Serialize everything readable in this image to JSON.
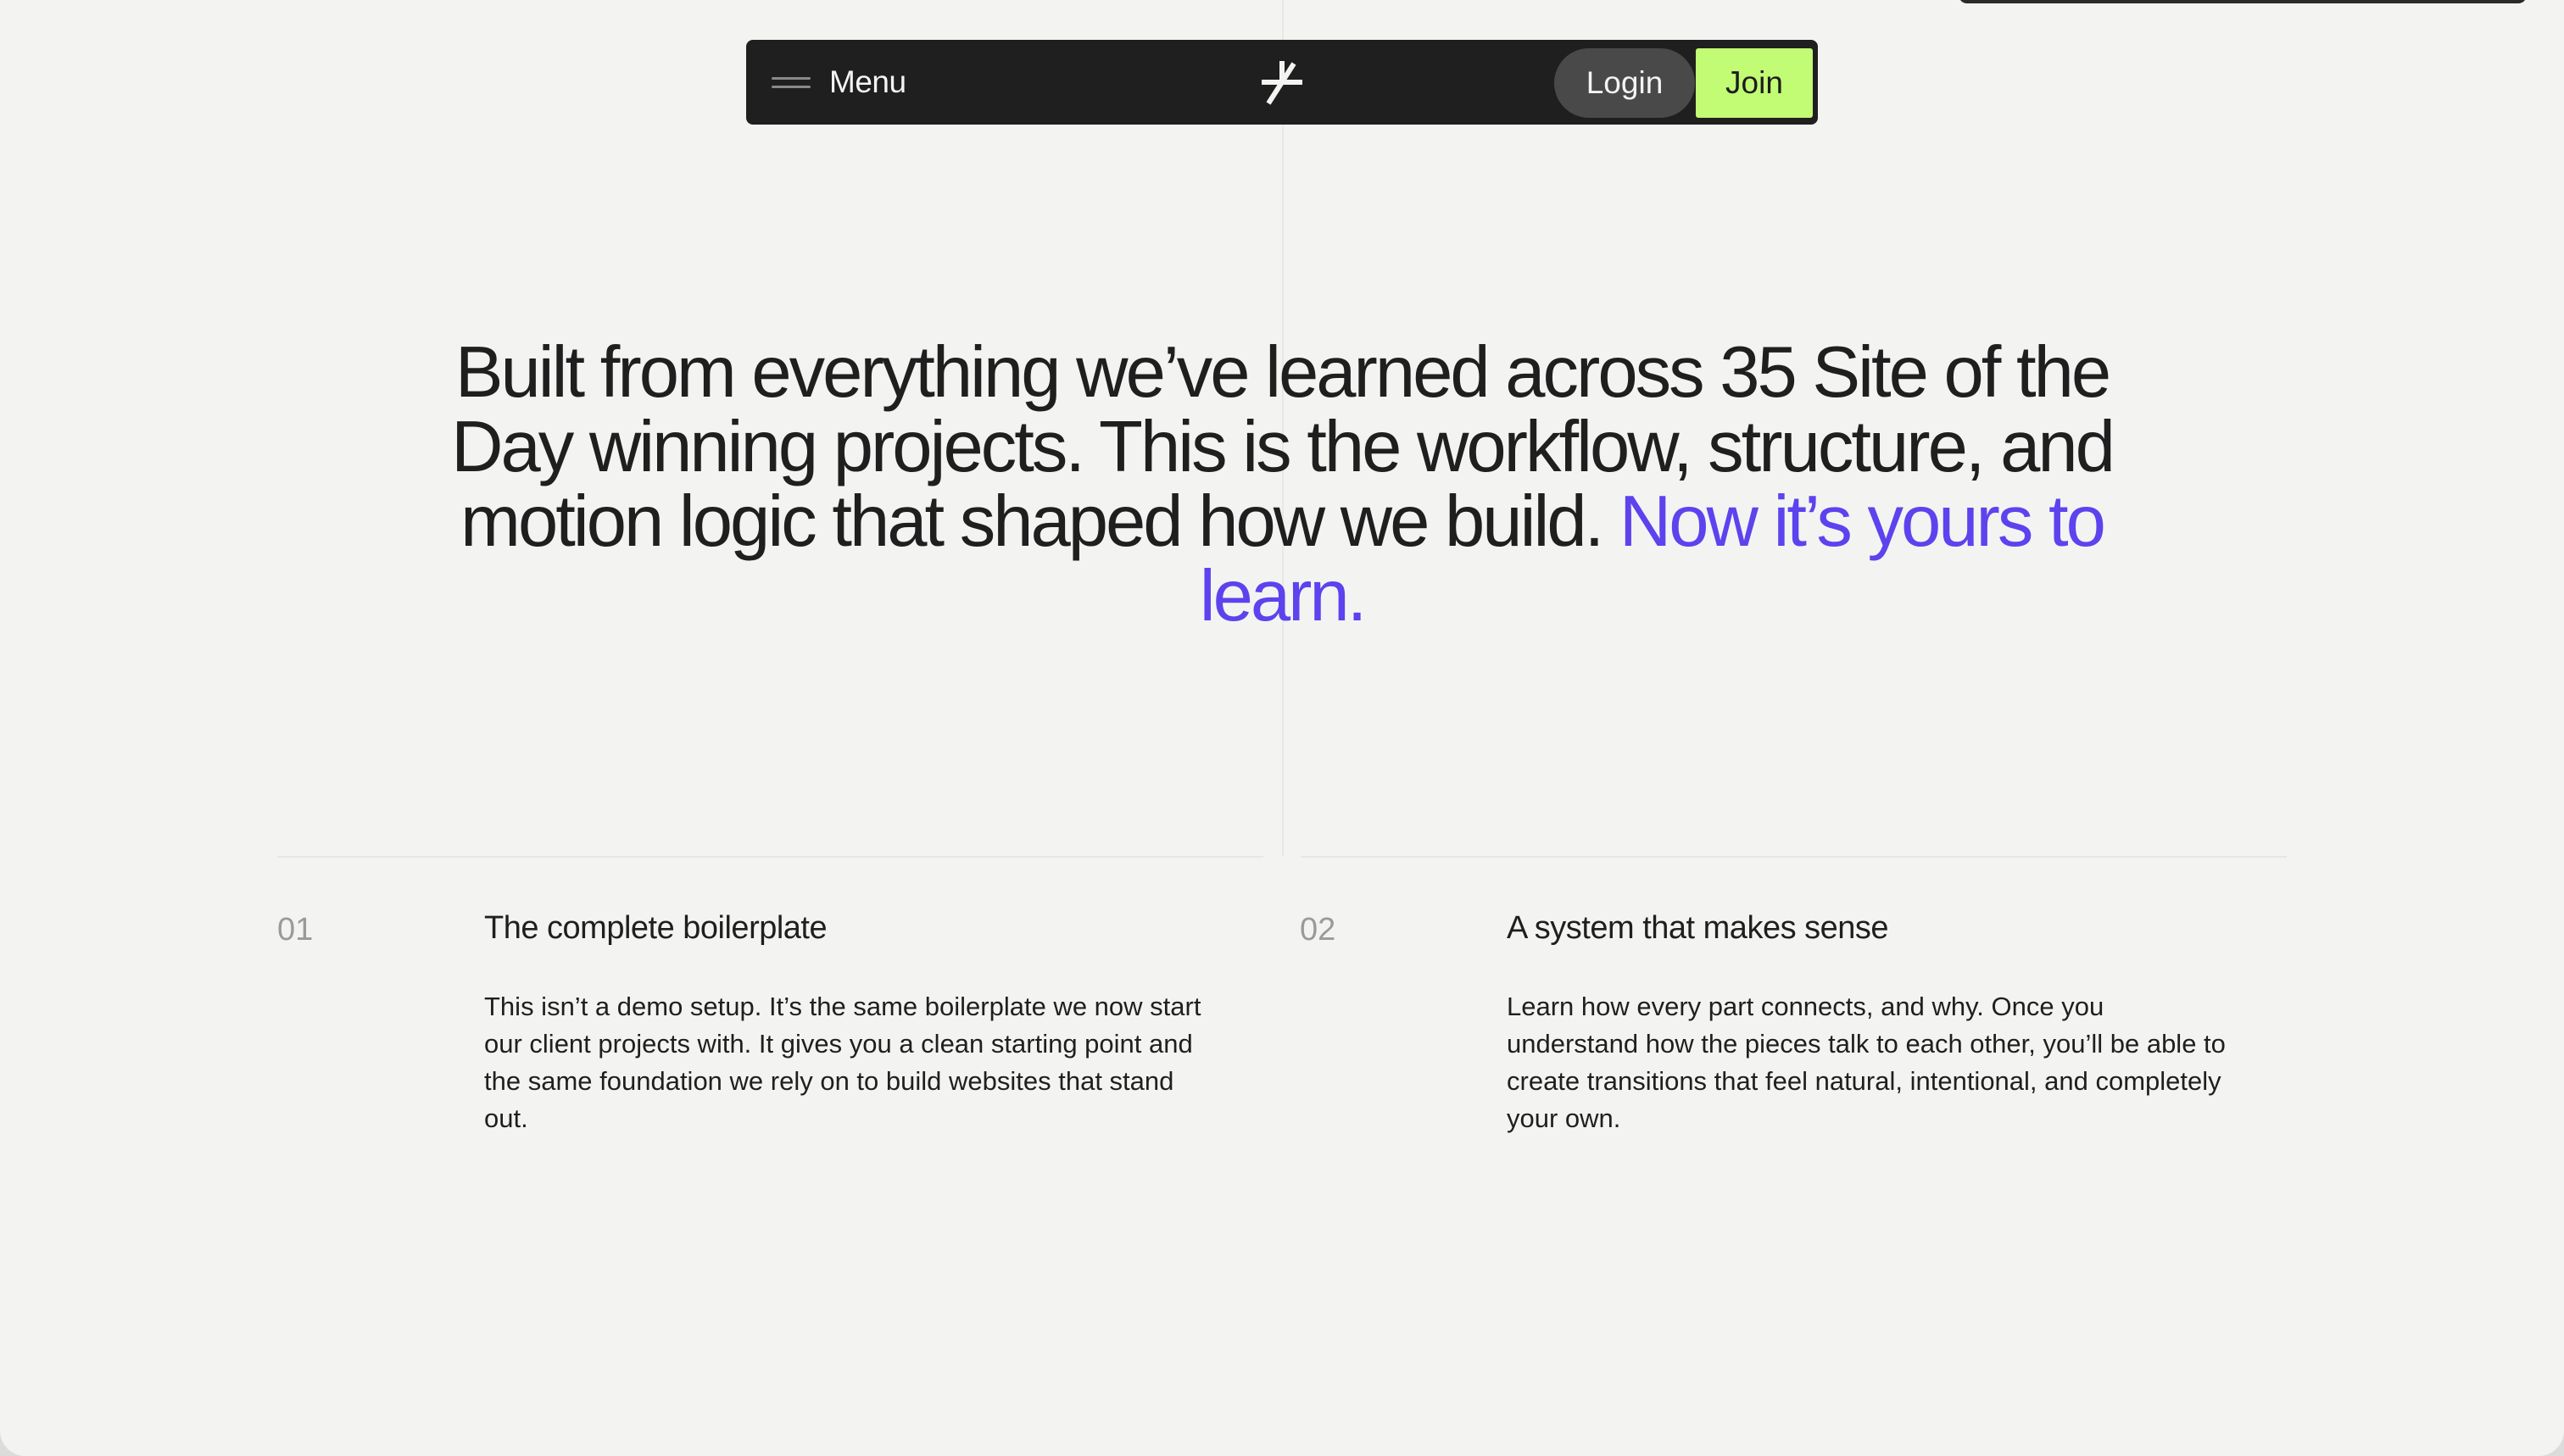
{
  "nav": {
    "menu_label": "Menu",
    "login_label": "Login",
    "join_label": "Join",
    "logo_icon": "asterisk-logo-icon"
  },
  "hero": {
    "headline_main": "Built from everything we’ve learned across 35 Site of the Day winning projects. This is the workflow, structure, and motion logic that shaped how we build.",
    "headline_accent": "Now it’s yours to learn."
  },
  "features": [
    {
      "number": "01",
      "title": "The complete boilerplate",
      "description": "This isn’t a demo setup. It’s the same boilerplate we now start our client projects with. It gives you a clean starting point and the same foundation we rely on to build websites that stand out."
    },
    {
      "number": "02",
      "title": "A system that makes sense",
      "description": "Learn how every part connects, and why. Once you understand how the pieces talk to each other, you’ll be able to create transitions that feel natural, intentional, and completely your own."
    }
  ],
  "colors": {
    "background": "#f3f4f2",
    "navbar": "#201f1f",
    "accent_purple": "#5c43ee",
    "join_green": "#c2fb74",
    "login_gray": "#4a4949"
  }
}
